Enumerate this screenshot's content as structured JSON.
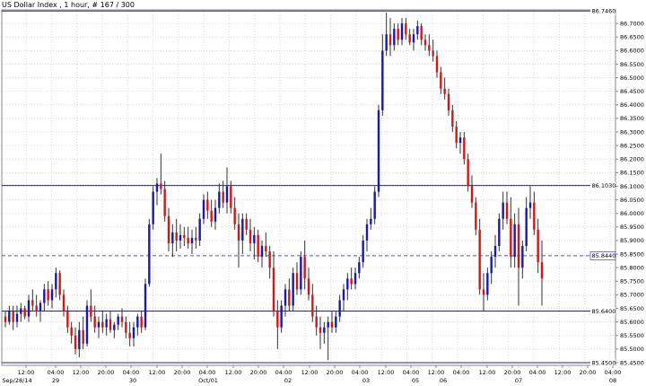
{
  "chart_data": {
    "type": "candlestick",
    "title": "US Dollar Index , 1 hour, # 167 / 300",
    "y_ticks": [
      "86.7000",
      "86.6500",
      "86.6000",
      "86.5500",
      "86.5000",
      "86.4500",
      "86.4000",
      "86.3500",
      "86.3000",
      "86.2500",
      "86.2000",
      "86.1500",
      "86.1000",
      "86.0500",
      "86.0000",
      "85.9500",
      "85.9000",
      "85.8500",
      "85.8000",
      "85.7500",
      "85.7000",
      "85.6500",
      "85.6000",
      "85.5500",
      "85.5000",
      "85.4500"
    ],
    "ylim": [
      85.44,
      86.75
    ],
    "x_ticks": [
      "12:00",
      "Sep/28/14",
      "04:00",
      "29",
      "12:00",
      "20:00",
      "04:00",
      "30",
      "12:00",
      "20:00",
      "04:00",
      "Oct/01",
      "12:00",
      "20:00",
      "04:00",
      "02",
      "12:00",
      "20:00",
      "04:00",
      "03",
      "12:00",
      "04:00",
      "05",
      "12:00",
      "04:00",
      "06",
      "12:00",
      "20:00",
      "04:00",
      "07",
      "12:00",
      "20:00",
      "04:00",
      "08"
    ],
    "levels": [
      {
        "label": "86.7460",
        "value": 86.746,
        "style": "solid",
        "color": "#2a2a5a"
      },
      {
        "label": "86.1030",
        "value": 86.103,
        "style": "solid",
        "color": "#2a2a5a"
      },
      {
        "label": "85.8440",
        "value": 85.844,
        "style": "dashed",
        "color": "#5a5aa8"
      },
      {
        "label": "85.6400",
        "value": 85.64,
        "style": "solid",
        "color": "#2a2a5a"
      },
      {
        "label": "85.4500",
        "value": 85.45,
        "style": "solid",
        "color": "#2a2a5a"
      }
    ],
    "colors": {
      "up": "#1a1aa8",
      "down": "#cc1a1a",
      "wick": "#333333",
      "grid": "#d8d8d8",
      "frame": "#888888"
    },
    "candles": [
      [
        85.62,
        85.64,
        85.58,
        85.6
      ],
      [
        85.6,
        85.66,
        85.59,
        85.64
      ],
      [
        85.64,
        85.66,
        85.57,
        85.6
      ],
      [
        85.6,
        85.66,
        85.58,
        85.63
      ],
      [
        85.63,
        85.67,
        85.6,
        85.65
      ],
      [
        85.65,
        85.66,
        85.61,
        85.62
      ],
      [
        85.62,
        85.7,
        85.6,
        85.68
      ],
      [
        85.68,
        85.72,
        85.64,
        85.66
      ],
      [
        85.66,
        85.7,
        85.62,
        85.64
      ],
      [
        85.64,
        85.68,
        85.6,
        85.67
      ],
      [
        85.67,
        85.74,
        85.64,
        85.72
      ],
      [
        85.72,
        85.75,
        85.66,
        85.68
      ],
      [
        85.68,
        85.74,
        85.65,
        85.72
      ],
      [
        85.72,
        85.8,
        85.69,
        85.78
      ],
      [
        85.78,
        85.79,
        85.68,
        85.7
      ],
      [
        85.7,
        85.72,
        85.62,
        85.64
      ],
      [
        85.64,
        85.66,
        85.56,
        85.58
      ],
      [
        85.58,
        85.6,
        85.52,
        85.55
      ],
      [
        85.55,
        85.58,
        85.48,
        85.5
      ],
      [
        85.5,
        85.6,
        85.47,
        85.57
      ],
      [
        85.57,
        85.62,
        85.5,
        85.52
      ],
      [
        85.52,
        85.68,
        85.51,
        85.66
      ],
      [
        85.66,
        85.72,
        85.6,
        85.62
      ],
      [
        85.62,
        85.66,
        85.56,
        85.58
      ],
      [
        85.58,
        85.62,
        85.54,
        85.6
      ],
      [
        85.6,
        85.64,
        85.56,
        85.58
      ],
      [
        85.58,
        85.63,
        85.55,
        85.61
      ],
      [
        85.61,
        85.64,
        85.56,
        85.57
      ],
      [
        85.57,
        85.6,
        85.54,
        85.59
      ],
      [
        85.59,
        85.63,
        85.57,
        85.62
      ],
      [
        85.62,
        85.65,
        85.58,
        85.6
      ],
      [
        85.6,
        85.62,
        85.54,
        85.56
      ],
      [
        85.56,
        85.6,
        85.51,
        85.54
      ],
      [
        85.54,
        85.6,
        85.51,
        85.58
      ],
      [
        85.58,
        85.63,
        85.55,
        85.62
      ],
      [
        85.62,
        85.64,
        85.56,
        85.58
      ],
      [
        85.58,
        85.76,
        85.57,
        85.74
      ],
      [
        85.74,
        85.98,
        85.73,
        85.96
      ],
      [
        85.96,
        86.1,
        85.94,
        86.08
      ],
      [
        86.08,
        86.13,
        86.03,
        86.11
      ],
      [
        86.11,
        86.22,
        86.07,
        86.09
      ],
      [
        86.09,
        86.12,
        85.97,
        85.99
      ],
      [
        85.99,
        86.02,
        85.86,
        85.89
      ],
      [
        85.89,
        85.96,
        85.84,
        85.93
      ],
      [
        85.93,
        85.98,
        85.86,
        85.9
      ],
      [
        85.9,
        85.96,
        85.87,
        85.92
      ],
      [
        85.92,
        85.95,
        85.88,
        85.91
      ],
      [
        85.91,
        85.95,
        85.87,
        85.89
      ],
      [
        85.89,
        85.94,
        85.85,
        85.91
      ],
      [
        85.91,
        85.95,
        85.87,
        85.9
      ],
      [
        85.9,
        86.0,
        85.88,
        85.98
      ],
      [
        85.98,
        86.07,
        85.96,
        86.05
      ],
      [
        86.05,
        86.08,
        85.98,
        86.01
      ],
      [
        86.01,
        86.05,
        85.95,
        85.97
      ],
      [
        85.97,
        86.05,
        85.94,
        86.02
      ],
      [
        86.02,
        86.11,
        86.0,
        86.08
      ],
      [
        86.08,
        86.12,
        86.02,
        86.04
      ],
      [
        86.04,
        86.17,
        86.0,
        86.1
      ],
      [
        86.1,
        86.12,
        86.0,
        86.02
      ],
      [
        86.02,
        86.06,
        85.94,
        85.96
      ],
      [
        85.96,
        86.0,
        85.8,
        85.9
      ],
      [
        85.9,
        86.0,
        85.85,
        85.98
      ],
      [
        85.98,
        86.0,
        85.92,
        85.94
      ],
      [
        85.94,
        85.98,
        85.86,
        85.89
      ],
      [
        85.89,
        85.95,
        85.83,
        85.92
      ],
      [
        85.92,
        85.94,
        85.82,
        85.84
      ],
      [
        85.84,
        85.9,
        85.8,
        85.88
      ],
      [
        85.88,
        85.93,
        85.84,
        85.86
      ],
      [
        85.86,
        85.88,
        85.76,
        85.8
      ],
      [
        85.8,
        85.86,
        85.62,
        85.64
      ],
      [
        85.64,
        85.68,
        85.5,
        85.58
      ],
      [
        85.58,
        85.68,
        85.56,
        85.66
      ],
      [
        85.66,
        85.74,
        85.62,
        85.72
      ],
      [
        85.72,
        85.76,
        85.64,
        85.66
      ],
      [
        85.66,
        85.8,
        85.64,
        85.78
      ],
      [
        85.78,
        85.82,
        85.7,
        85.72
      ],
      [
        85.72,
        85.86,
        85.7,
        85.84
      ],
      [
        85.84,
        85.9,
        85.72,
        85.76
      ],
      [
        85.76,
        85.8,
        85.68,
        85.7
      ],
      [
        85.7,
        85.74,
        85.6,
        85.62
      ],
      [
        85.62,
        85.66,
        85.55,
        85.58
      ],
      [
        85.58,
        85.62,
        85.5,
        85.56
      ],
      [
        85.56,
        85.6,
        85.52,
        85.58
      ],
      [
        85.58,
        85.62,
        85.46,
        85.6
      ],
      [
        85.6,
        85.64,
        85.56,
        85.58
      ],
      [
        85.58,
        85.64,
        85.56,
        85.62
      ],
      [
        85.62,
        85.7,
        85.6,
        85.68
      ],
      [
        85.68,
        85.74,
        85.64,
        85.72
      ],
      [
        85.72,
        85.78,
        85.68,
        85.76
      ],
      [
        85.76,
        85.8,
        85.72,
        85.74
      ],
      [
        85.74,
        85.8,
        85.72,
        85.78
      ],
      [
        85.78,
        85.84,
        85.76,
        85.82
      ],
      [
        85.82,
        85.92,
        85.8,
        85.9
      ],
      [
        85.9,
        85.98,
        85.86,
        85.96
      ],
      [
        85.96,
        86.02,
        85.94,
        85.98
      ],
      [
        85.98,
        86.1,
        85.96,
        86.08
      ],
      [
        86.08,
        86.4,
        86.06,
        86.38
      ],
      [
        86.38,
        86.66,
        86.36,
        86.6
      ],
      [
        86.6,
        86.74,
        86.58,
        86.66
      ],
      [
        86.66,
        86.72,
        86.58,
        86.62
      ],
      [
        86.62,
        86.7,
        86.6,
        86.68
      ],
      [
        86.68,
        86.7,
        86.62,
        86.64
      ],
      [
        86.64,
        86.72,
        86.62,
        86.7
      ],
      [
        86.7,
        86.72,
        86.64,
        86.66
      ],
      [
        86.66,
        86.68,
        86.62,
        86.63
      ],
      [
        86.63,
        86.68,
        86.6,
        86.66
      ],
      [
        86.66,
        86.71,
        86.64,
        86.69
      ],
      [
        86.69,
        86.7,
        86.62,
        86.64
      ],
      [
        86.64,
        86.66,
        86.6,
        86.62
      ],
      [
        86.62,
        86.66,
        86.58,
        86.6
      ],
      [
        86.6,
        86.64,
        86.56,
        86.58
      ],
      [
        86.58,
        86.6,
        86.5,
        86.52
      ],
      [
        86.52,
        86.54,
        86.44,
        86.46
      ],
      [
        86.46,
        86.5,
        86.42,
        86.44
      ],
      [
        86.44,
        86.46,
        86.36,
        86.38
      ],
      [
        86.38,
        86.4,
        86.3,
        86.32
      ],
      [
        86.32,
        86.34,
        86.24,
        86.26
      ],
      [
        86.26,
        86.3,
        86.22,
        86.28
      ],
      [
        86.28,
        86.3,
        86.18,
        86.2
      ],
      [
        86.2,
        86.22,
        86.08,
        86.1
      ],
      [
        86.1,
        86.14,
        86.02,
        86.04
      ],
      [
        86.04,
        86.06,
        85.92,
        85.94
      ],
      [
        85.94,
        85.98,
        85.7,
        85.72
      ],
      [
        85.72,
        85.78,
        85.64,
        85.7
      ],
      [
        85.7,
        85.8,
        85.68,
        85.78
      ],
      [
        85.78,
        85.86,
        85.74,
        85.84
      ],
      [
        85.84,
        85.92,
        85.8,
        85.88
      ],
      [
        85.88,
        86.0,
        85.86,
        85.98
      ],
      [
        85.98,
        86.08,
        85.94,
        86.04
      ],
      [
        86.04,
        86.08,
        85.96,
        85.98
      ],
      [
        85.98,
        86.06,
        85.8,
        85.84
      ],
      [
        85.84,
        86.0,
        85.8,
        85.96
      ],
      [
        85.96,
        86.02,
        85.66,
        85.8
      ],
      [
        85.8,
        85.9,
        85.76,
        85.88
      ],
      [
        85.88,
        86.06,
        85.86,
        86.02
      ],
      [
        86.02,
        86.1,
        85.98,
        86.04
      ],
      [
        86.04,
        86.08,
        85.92,
        85.94
      ],
      [
        85.94,
        85.98,
        85.78,
        85.82
      ],
      [
        85.82,
        85.9,
        85.66,
        85.76
      ]
    ]
  }
}
